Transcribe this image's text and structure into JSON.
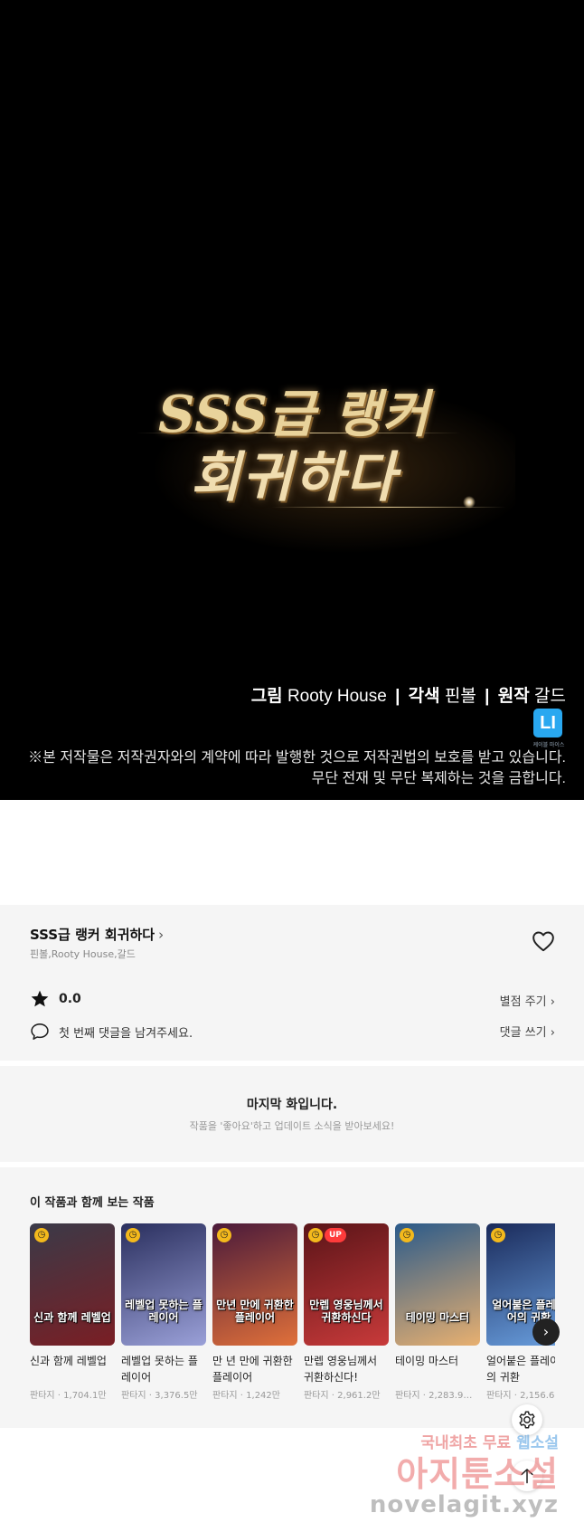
{
  "panel": {
    "logo_line1": "SSS급 랭커",
    "logo_line2": "회귀하다",
    "credits": {
      "art_label": "그림",
      "art_name": "Rooty House",
      "color_label": "각색",
      "color_name": "핀볼",
      "original_label": "원작",
      "original_name": "갈드",
      "separator": "|"
    },
    "badge_text": "LI",
    "badge_sub": "케이블 마이스",
    "notice_line1": "※본 저작물은 저작권자와의 계약에 따라 발행한 것으로 저작권법의 보호를 받고 있습니다.",
    "notice_line2": "무단 전재 및 무단 복제하는 것을 금합니다."
  },
  "series": {
    "title": "SSS급 랭커 회귀하다",
    "authors": "핀볼,Rooty House,갈드",
    "rating": "0.0",
    "rate_link": "별점 주기",
    "comment_placeholder": "첫 번째 댓글을 남겨주세요.",
    "comment_link": "댓글 쓰기"
  },
  "last_episode": {
    "title": "마지막 화입니다.",
    "subtitle": "작품을 '좋아요'하고 업데이트 소식을 받아보세요!"
  },
  "recommendations": {
    "title": "이 작품과 함께 보는 작품",
    "items": [
      {
        "name": "신과 함께 레벨업",
        "genre": "판타지",
        "views": "1,704.1만",
        "cover_text": "신과 함께 레벨업",
        "up": false,
        "colors": [
          "#3a3a48",
          "#7a1e24"
        ]
      },
      {
        "name": "레벨업 못하는 플레이어",
        "genre": "판타지",
        "views": "3,376.5만",
        "cover_text": "레벨업 못하는 플레이어",
        "up": false,
        "colors": [
          "#2a2f5e",
          "#9aa0d8"
        ]
      },
      {
        "name": "만 년 만에 귀환한 플레이어",
        "genre": "판타지",
        "views": "1,242만",
        "cover_text": "만년 만에 귀환한 플레이어",
        "up": false,
        "colors": [
          "#4a1a3a",
          "#e0703a"
        ]
      },
      {
        "name": "만렙 영웅님께서 귀환하신다!",
        "genre": "판타지",
        "views": "2,961.2만",
        "cover_text": "만렙 영웅님께서 귀환하신다",
        "up": true,
        "up_label": "UP",
        "colors": [
          "#5a1418",
          "#c83a3a"
        ]
      },
      {
        "name": "테이밍 마스터",
        "genre": "판타지",
        "views": "2,283.9…",
        "cover_text": "테이밍 마스터",
        "up": false,
        "colors": [
          "#2a5a8a",
          "#e8b070"
        ]
      },
      {
        "name": "얼어붙은 플레이어의 귀환",
        "genre": "판타지",
        "views": "2,156.6",
        "cover_text": "얼어붙은 플레이어의 귀환",
        "up": false,
        "colors": [
          "#1a2a5a",
          "#6aa0e0"
        ]
      }
    ],
    "meta_separator": " · "
  },
  "watermark": {
    "line1_a": "국내최초 무료 ",
    "line1_b": "웹소설",
    "line2": "아지툰소설",
    "line3": "novelagit.xyz"
  },
  "icons": {
    "heart": "heart-icon",
    "star": "star-icon",
    "comment": "comment-icon",
    "next": "chevron-right-icon",
    "settings": "gear-icon",
    "top": "arrow-up-icon"
  }
}
